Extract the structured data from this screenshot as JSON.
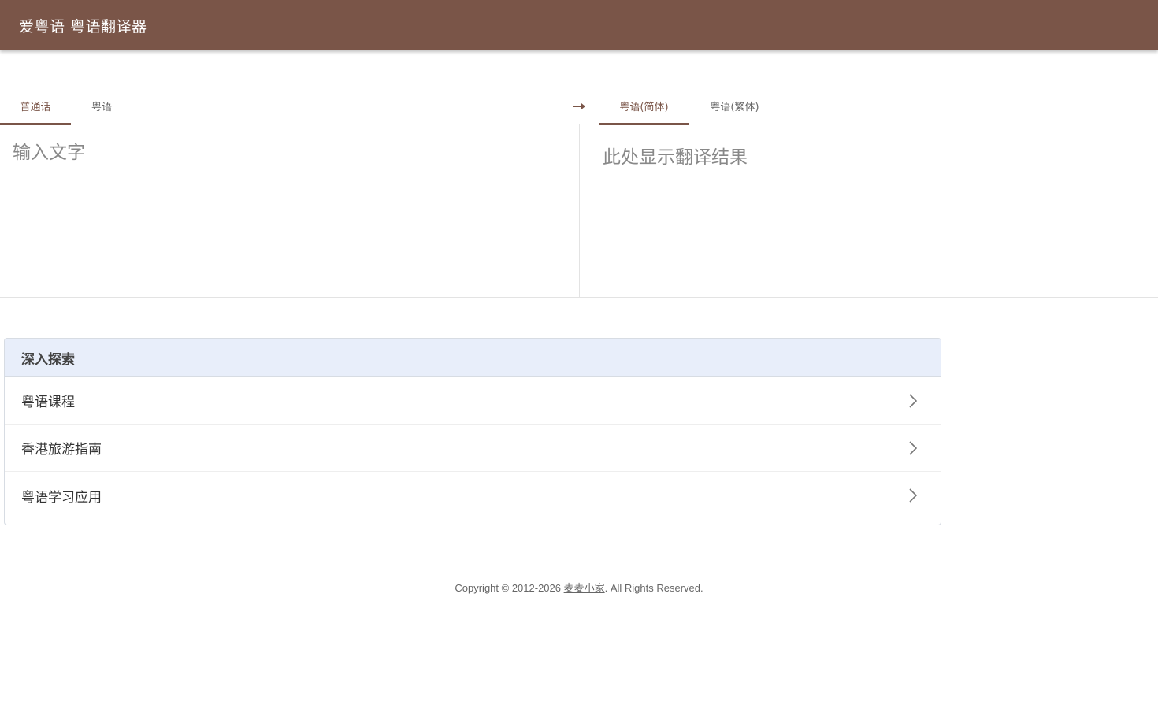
{
  "app_bar": {
    "title": "爱粤语 粤语翻译器",
    "color": "#7a5548"
  },
  "source_languages": [
    {
      "label": "普通话",
      "active": true
    },
    {
      "label": "粤语",
      "active": false
    }
  ],
  "swap_icon": "right-arrow-icon",
  "target_languages": [
    {
      "label": "粤语(简体)",
      "active": true
    },
    {
      "label": "粤语(繁体)",
      "active": false
    }
  ],
  "input": {
    "placeholder": "输入文字",
    "value": ""
  },
  "output": {
    "placeholder": "此处显示翻译结果"
  },
  "explore": {
    "title": "深入探索",
    "items": [
      {
        "label": "粤语课程",
        "icon": "chevron-right-icon"
      },
      {
        "label": "香港旅游指南",
        "icon": "chevron-right-icon"
      },
      {
        "label": "粤语学习应用",
        "icon": "chevron-right-icon"
      }
    ]
  },
  "footer": {
    "prefix": "Copyright © 2012-2026 ",
    "link": "麦麦小家",
    "suffix": ". All Rights Reserved."
  }
}
